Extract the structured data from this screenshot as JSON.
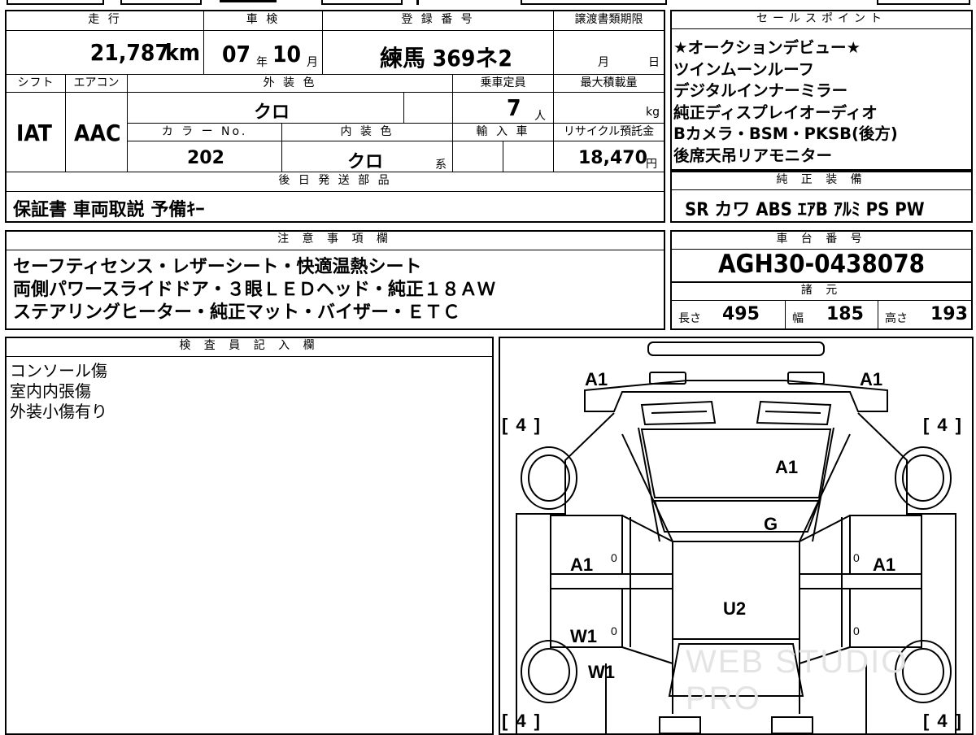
{
  "top_info": {
    "headers": {
      "mileage": "走 行",
      "inspection": "車 検",
      "registration": "登 録 番 号",
      "transfer_deadline": "譲渡書類期限"
    },
    "mileage": {
      "value": "21,787",
      "unit": "km"
    },
    "inspection": {
      "year": "07",
      "year_unit": "年",
      "month": "10",
      "month_unit": "月"
    },
    "registration": "練馬 369ネ2",
    "transfer_deadline": {
      "month_unit": "月",
      "day_unit": "日"
    },
    "row2_headers": {
      "shift": "シフト",
      "aircon": "エアコン",
      "exterior_color": "外 装 色",
      "capacity": "乗車定員",
      "max_load": "最大積載量"
    },
    "shift": "IAT",
    "aircon": "AAC",
    "exterior_color": "クロ",
    "capacity": {
      "value": "7",
      "unit": "人"
    },
    "max_load": {
      "unit": "kg"
    },
    "row3_headers": {
      "color_no": "カ ラ ー No.",
      "interior_color": "内 装 色",
      "import": "輸 入 車",
      "recycle": "リサイクル預託金"
    },
    "color_no": "202",
    "interior_color": "クロ",
    "interior_suffix": "系",
    "recycle": {
      "value": "18,470",
      "unit": "円"
    },
    "later_parts_header": "後 日 発 送 部 品",
    "later_parts": "保証書 車両取説 予備ｷｰ"
  },
  "sales_points": {
    "header": "セールスポイント",
    "lines": [
      "★オークションデビュー★",
      "ツインムーンルーフ",
      "デジタルインナーミラー",
      "純正ディスプレイオーディオ",
      "Bカメラ・BSM・PKSB(後方)",
      "後席天吊リアモニター"
    ]
  },
  "equipment": {
    "header": "純 正 装 備",
    "items": "SR カワ ABS ｴｱB ｱﾙﾐ PS PW"
  },
  "notes": {
    "header": "注 意 事 項 欄",
    "lines": [
      "セーフティセンス・レザーシート・快適温熱シート",
      "両側パワースライドドア・３眼ＬＥＤヘッド・純正１８ＡＷ",
      "ステアリングヒーター・純正マット・バイザー・ＥＴＣ"
    ]
  },
  "chassis": {
    "header": "車 台 番 号",
    "number": "AGH30-0438078"
  },
  "specs": {
    "header": "諸 元",
    "length_label": "長さ",
    "length": "495",
    "width_label": "幅",
    "width": "185",
    "height_label": "高さ",
    "height": "193"
  },
  "inspector": {
    "header": "検 査 員 記 入 欄",
    "lines": [
      "コンソール傷",
      "室内内張傷",
      "外装小傷有り"
    ]
  },
  "diagram": {
    "marks": {
      "front_left": "A1",
      "front_right": "A1",
      "hood": "A1",
      "windshield": "G",
      "left_front_door": "A1",
      "right_front_door": "A1",
      "roof": "U2",
      "left_rear_door": "W1",
      "left_rear_quarter": "W1"
    },
    "ticks": [
      "0",
      "0",
      "0",
      "0"
    ],
    "tires": [
      "4",
      "4",
      "4",
      "4"
    ],
    "watermark": "WEB STUDIO PRO"
  }
}
